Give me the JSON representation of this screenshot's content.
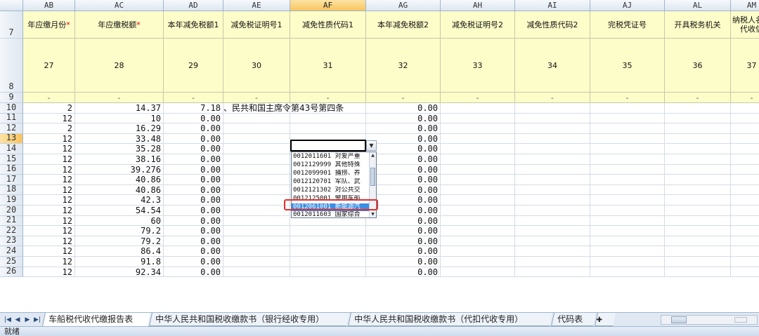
{
  "columns": [
    {
      "letter": "AB",
      "header": "年应缴月份",
      "required": true,
      "code": "27"
    },
    {
      "letter": "AC",
      "header": "年应缴税额",
      "required": true,
      "code": "28"
    },
    {
      "letter": "AD",
      "header": "本年减免税额1",
      "required": false,
      "code": "29"
    },
    {
      "letter": "AE",
      "header": "减免税证明号1",
      "required": false,
      "code": "30"
    },
    {
      "letter": "AF",
      "header": "减免性质代码1",
      "required": false,
      "code": "31"
    },
    {
      "letter": "AG",
      "header": "本年减免税额2",
      "required": false,
      "code": "32"
    },
    {
      "letter": "AH",
      "header": "减免税证明号2",
      "required": false,
      "code": "33"
    },
    {
      "letter": "AI",
      "header": "减免性质代码2",
      "required": false,
      "code": "34"
    },
    {
      "letter": "AJ",
      "header": "完税凭证号",
      "required": false,
      "code": "35"
    },
    {
      "letter": "AL",
      "header": "开具税务机关",
      "required": false,
      "code": "36"
    },
    {
      "letter": "AM",
      "header": "纳税人名称 代收信",
      "required": false,
      "code": "37"
    }
  ],
  "header_rows": [
    "7",
    "8",
    "9"
  ],
  "dash": "-",
  "required_mark": "*",
  "rows": [
    {
      "num": "10",
      "ab": "2",
      "ac": "14.37",
      "ad": "7.18",
      "ae_overflow": "、民共和国主席令第43号第四条",
      "ag": "0.00"
    },
    {
      "num": "11",
      "ab": "12",
      "ac": "10",
      "ad": "0.00",
      "ae_overflow": "",
      "ag": "0.00"
    },
    {
      "num": "12",
      "ab": "2",
      "ac": "16.29",
      "ad": "0.00",
      "ae_overflow": "",
      "ag": "0.00"
    },
    {
      "num": "13",
      "ab": "12",
      "ac": "33.48",
      "ad": "0.00",
      "ae_overflow": "",
      "ag": "0.00"
    },
    {
      "num": "14",
      "ab": "12",
      "ac": "35.28",
      "ad": "0.00",
      "ae_overflow": "",
      "ag": "0.00"
    },
    {
      "num": "15",
      "ab": "12",
      "ac": "38.16",
      "ad": "0.00",
      "ae_overflow": "",
      "ag": "0.00"
    },
    {
      "num": "16",
      "ab": "12",
      "ac": "39.276",
      "ad": "0.00",
      "ae_overflow": "",
      "ag": "0.00"
    },
    {
      "num": "17",
      "ab": "12",
      "ac": "40.86",
      "ad": "0.00",
      "ae_overflow": "",
      "ag": "0.00"
    },
    {
      "num": "18",
      "ab": "12",
      "ac": "40.86",
      "ad": "0.00",
      "ae_overflow": "",
      "ag": "0.00"
    },
    {
      "num": "19",
      "ab": "12",
      "ac": "42.3",
      "ad": "0.00",
      "ae_overflow": "",
      "ag": "0.00"
    },
    {
      "num": "20",
      "ab": "12",
      "ac": "54.54",
      "ad": "0.00",
      "ae_overflow": "",
      "ag": "0.00"
    },
    {
      "num": "21",
      "ab": "12",
      "ac": "60",
      "ad": "0.00",
      "ae_overflow": "",
      "ag": "0.00"
    },
    {
      "num": "22",
      "ab": "12",
      "ac": "79.2",
      "ad": "0.00",
      "ae_overflow": "",
      "ag": "0.00"
    },
    {
      "num": "23",
      "ab": "12",
      "ac": "79.2",
      "ad": "0.00",
      "ae_overflow": "",
      "ag": "0.00"
    },
    {
      "num": "24",
      "ab": "12",
      "ac": "86.4",
      "ad": "0.00",
      "ae_overflow": "",
      "ag": "0.00"
    },
    {
      "num": "25",
      "ab": "12",
      "ac": "91.8",
      "ad": "0.00",
      "ae_overflow": "",
      "ag": "0.00"
    },
    {
      "num": "26",
      "ab": "12",
      "ac": "92.34",
      "ad": "0.00",
      "ae_overflow": "",
      "ag": "0.00"
    }
  ],
  "dropdown": {
    "current_value": "",
    "items": [
      "0012011601 对爱严重",
      "0012129999 其他特殊",
      "0012099901 捕捞、养",
      "0012120701 军队、武",
      "0012121302 对公共交",
      "0012125001 警用车船",
      "0012061001 新能源汽",
      "0012011603 国家综合"
    ],
    "selected_index": 6
  },
  "sheet_tabs": [
    "车船税代收代缴报告表",
    "中华人民共和国税收缴款书（银行经收专用）",
    "中华人民共和国税收缴款书（代扣代收专用）",
    "代码表"
  ],
  "active_tab": 0,
  "status": "就绪",
  "colors": {
    "header_fill": "#fdfdc9",
    "active_col": "#f8c45f",
    "selection": "#3b8ee2",
    "highlight": "#e03030"
  }
}
